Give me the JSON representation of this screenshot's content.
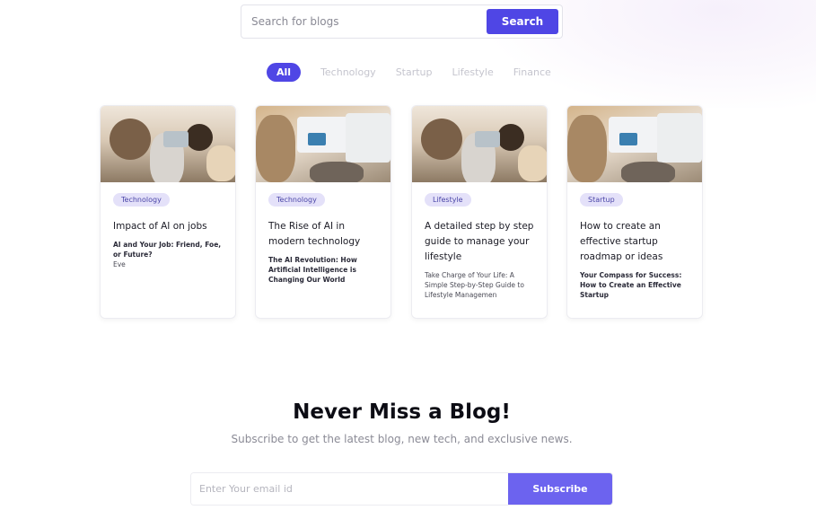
{
  "search": {
    "placeholder": "Search for blogs",
    "button_label": "Search"
  },
  "filters": [
    {
      "label": "All",
      "active": true
    },
    {
      "label": "Technology",
      "active": false
    },
    {
      "label": "Startup",
      "active": false
    },
    {
      "label": "Lifestyle",
      "active": false
    },
    {
      "label": "Finance",
      "active": false
    }
  ],
  "cards": [
    {
      "category": "Technology",
      "title": "Impact of AI on jobs",
      "subtitle": "AI and Your Job: Friend, Foe, or Future?",
      "author": "Eve"
    },
    {
      "category": "Technology",
      "title": "The Rise of AI in modern technology",
      "subtitle": "The AI Revolution: How Artificial Intelligence is Changing Our World",
      "author": ""
    },
    {
      "category": "Lifestyle",
      "title": "A detailed step by step guide to manage your lifestyle",
      "subtitle": "Take Charge of Your Life: A Simple Step-by-Step Guide to Lifestyle Managemen",
      "author": ""
    },
    {
      "category": "Startup",
      "title": "How to create an effective startup roadmap or ideas",
      "subtitle": "Your Compass for Success: How to Create an Effective Startup",
      "author": ""
    }
  ],
  "newsletter": {
    "title": "Never Miss a Blog!",
    "subtitle": "Subscribe to get the latest blog, new tech, and exclusive news.",
    "email_placeholder": "Enter Your email id",
    "button_label": "Subscribe"
  },
  "colors": {
    "accent": "#4f46e5",
    "subscribe_button": "#6c63ef",
    "badge_bg": "#e4e1f9"
  }
}
